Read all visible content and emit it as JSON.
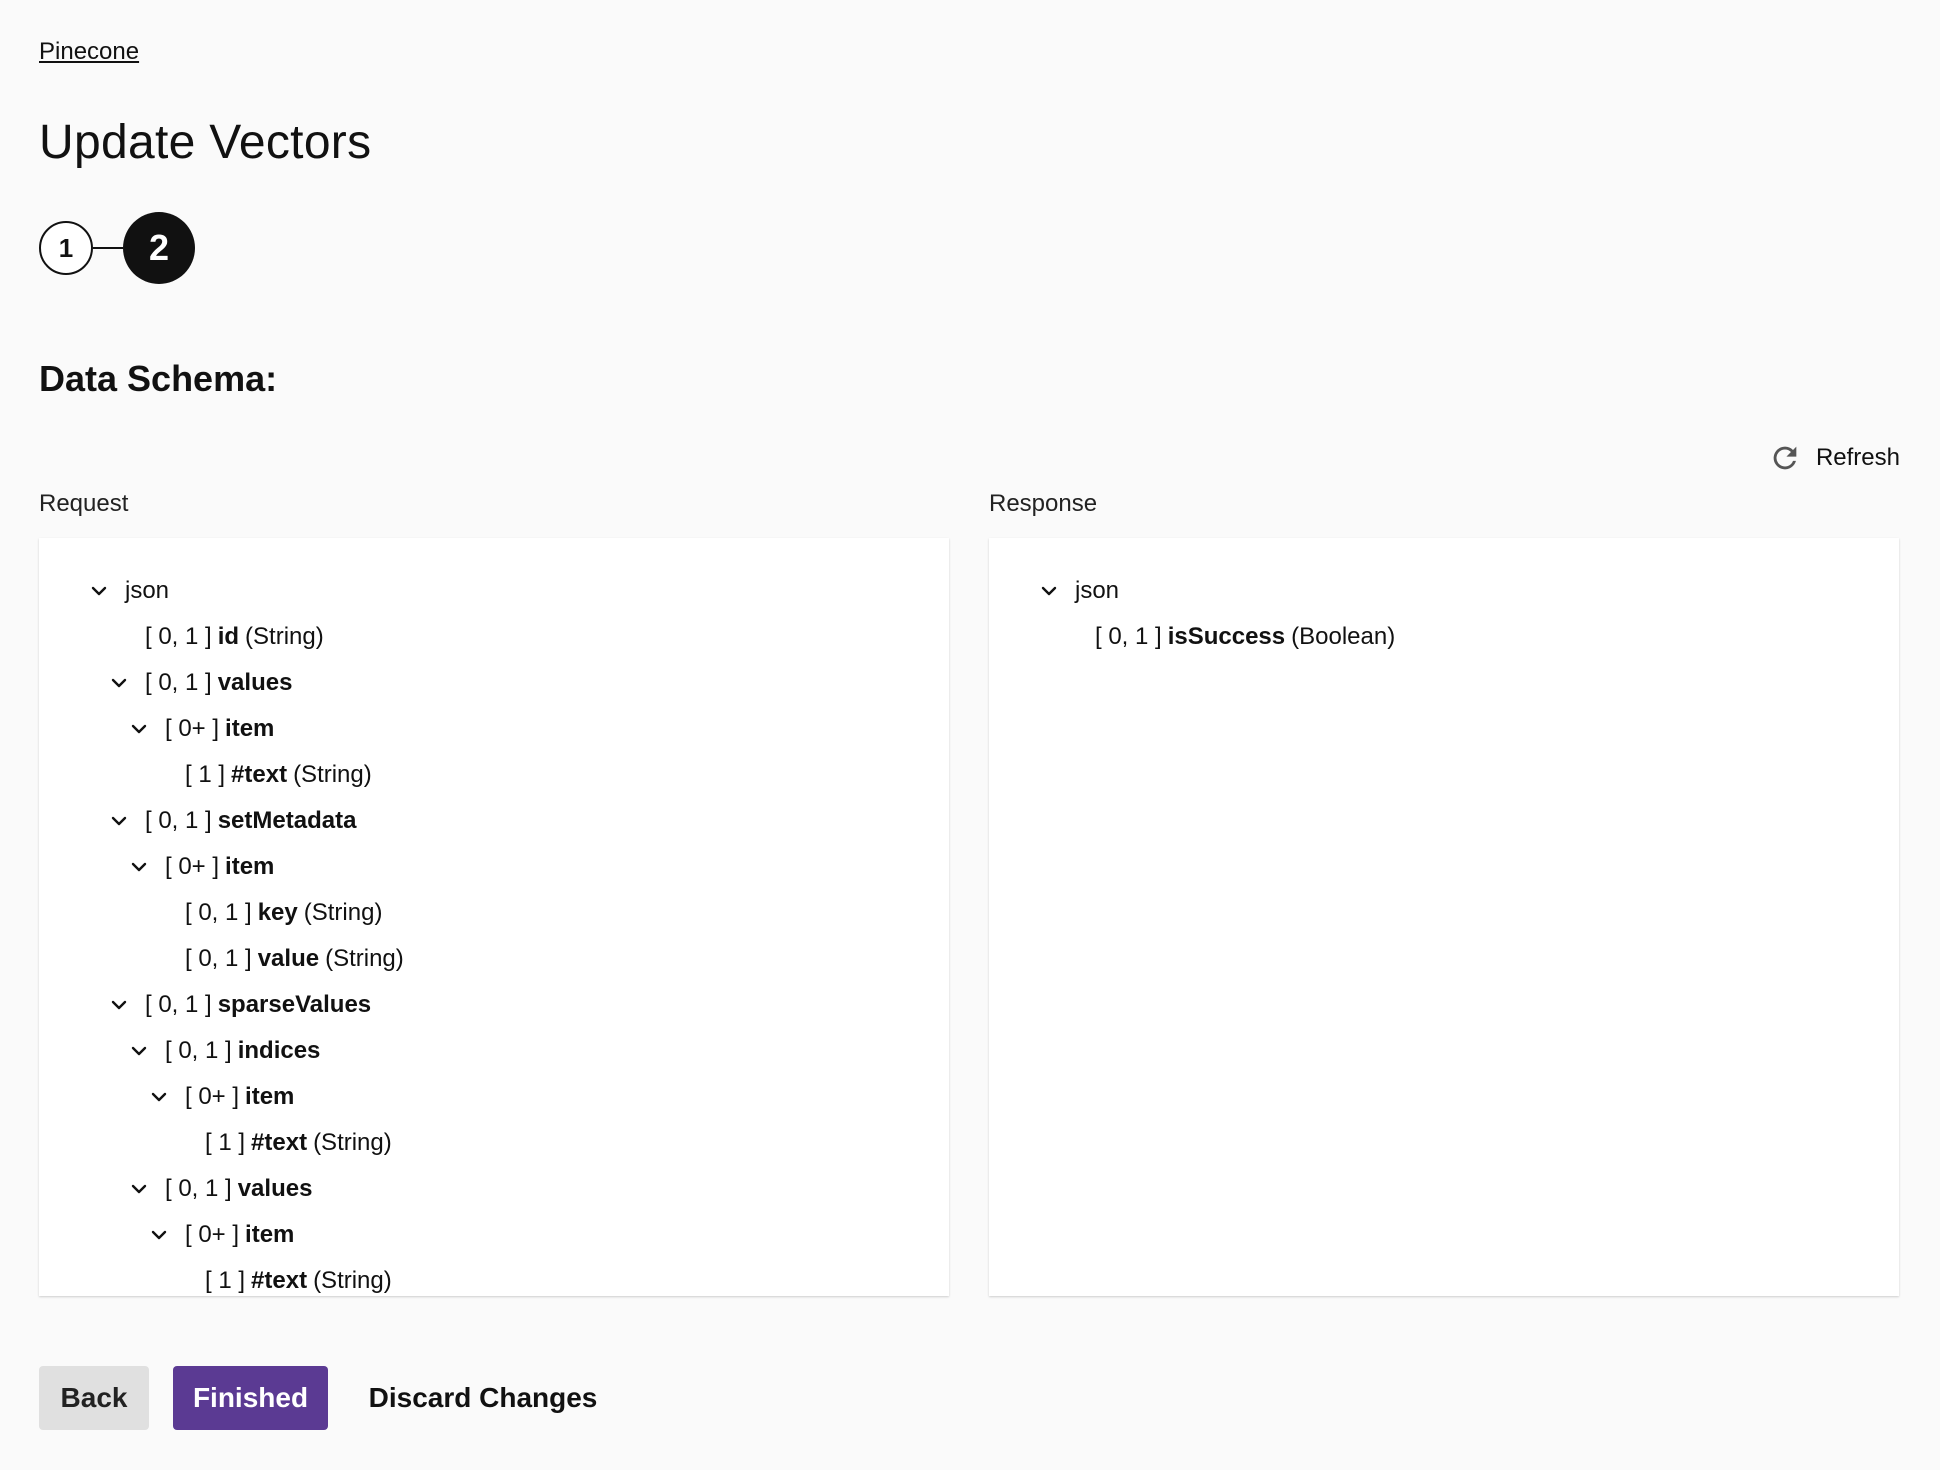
{
  "breadcrumb": "Pinecone",
  "title": "Update Vectors",
  "stepper": {
    "steps": [
      "1",
      "2"
    ],
    "active_step": 2
  },
  "section_title": "Data Schema:",
  "refresh_label": "Refresh",
  "request": {
    "label": "Request",
    "rows": [
      {
        "depth": 0,
        "expand": true,
        "bracket": "",
        "name": "json",
        "type": "",
        "root": true
      },
      {
        "depth": 1,
        "expand": false,
        "bracket": "[ 0, 1 ]",
        "name": "id",
        "type": "(String)"
      },
      {
        "depth": 1,
        "expand": true,
        "bracket": "[ 0, 1 ]",
        "name": "values",
        "type": ""
      },
      {
        "depth": 2,
        "expand": true,
        "bracket": "[ 0+ ]",
        "name": "item",
        "type": ""
      },
      {
        "depth": 3,
        "expand": false,
        "bracket": "[ 1 ]",
        "name": "#text",
        "type": "(String)"
      },
      {
        "depth": 1,
        "expand": true,
        "bracket": "[ 0, 1 ]",
        "name": "setMetadata",
        "type": ""
      },
      {
        "depth": 2,
        "expand": true,
        "bracket": "[ 0+ ]",
        "name": "item",
        "type": ""
      },
      {
        "depth": 3,
        "expand": false,
        "bracket": "[ 0, 1 ]",
        "name": "key",
        "type": "(String)"
      },
      {
        "depth": 3,
        "expand": false,
        "bracket": "[ 0, 1 ]",
        "name": "value",
        "type": "(String)"
      },
      {
        "depth": 1,
        "expand": true,
        "bracket": "[ 0, 1 ]",
        "name": "sparseValues",
        "type": ""
      },
      {
        "depth": 2,
        "expand": true,
        "bracket": "[ 0, 1 ]",
        "name": "indices",
        "type": ""
      },
      {
        "depth": 3,
        "expand": true,
        "bracket": "[ 0+ ]",
        "name": "item",
        "type": ""
      },
      {
        "depth": 4,
        "expand": false,
        "bracket": "[ 1 ]",
        "name": "#text",
        "type": "(String)"
      },
      {
        "depth": 2,
        "expand": true,
        "bracket": "[ 0, 1 ]",
        "name": "values",
        "type": ""
      },
      {
        "depth": 3,
        "expand": true,
        "bracket": "[ 0+ ]",
        "name": "item",
        "type": ""
      },
      {
        "depth": 4,
        "expand": false,
        "bracket": "[ 1 ]",
        "name": "#text",
        "type": "(String)"
      }
    ]
  },
  "response": {
    "label": "Response",
    "rows": [
      {
        "depth": 0,
        "expand": true,
        "bracket": "",
        "name": "json",
        "type": "",
        "root": true
      },
      {
        "depth": 1,
        "expand": false,
        "bracket": "[ 0, 1 ]",
        "name": "isSuccess",
        "type": "(Boolean)"
      }
    ]
  },
  "buttons": {
    "back": "Back",
    "finished": "Finished",
    "discard": "Discard Changes"
  },
  "colors": {
    "primary": "#5b3a93",
    "active_step": "#111111",
    "back_button": "#e0e0e0"
  },
  "icons": {
    "refresh": "refresh-icon",
    "expand": "chevron-down-icon"
  }
}
